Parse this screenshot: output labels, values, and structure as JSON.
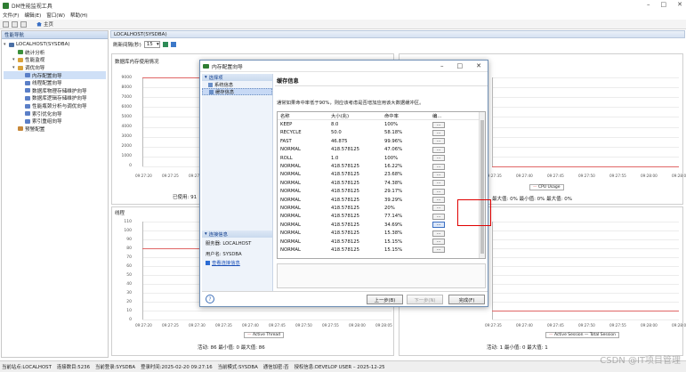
{
  "app": {
    "title": "DM性能监视工具",
    "icon": "app-icon"
  },
  "menu": [
    "文件(F)",
    "编辑(E)",
    "窗口(W)",
    "帮助(H)"
  ],
  "toolbar": {
    "home_label": "主页"
  },
  "left_panel": {
    "title": "性能导航",
    "tree": [
      {
        "label": "LOCALHOST(SYSDBA)",
        "level": 0,
        "icon": "server-icon"
      },
      {
        "label": "统计分析",
        "level": 1,
        "icon": "stats-icon"
      },
      {
        "label": "性能监视",
        "level": 1,
        "icon": "folder-icon"
      },
      {
        "label": "调优向导",
        "level": 1,
        "icon": "folder-icon"
      },
      {
        "label": "内存配置向导",
        "level": 2,
        "icon": "wizard-icon",
        "selected": true
      },
      {
        "label": "线程配置向导",
        "level": 2,
        "icon": "wizard-icon"
      },
      {
        "label": "数据库物理存储维护向导",
        "level": 2,
        "icon": "wizard-icon"
      },
      {
        "label": "数据库逻辑存储维护向导",
        "level": 2,
        "icon": "wizard-icon"
      },
      {
        "label": "性能瓶颈分析与调优向导",
        "level": 2,
        "icon": "wizard-icon"
      },
      {
        "label": "索引优化向导",
        "level": 2,
        "icon": "wizard-icon"
      },
      {
        "label": "索引重组向导",
        "level": 2,
        "icon": "wizard-icon"
      },
      {
        "label": "预警配置",
        "level": 1,
        "icon": "alert-icon"
      }
    ]
  },
  "main": {
    "tab": "LOCALHOST(SYSDBA)",
    "refresh_label": "刷新间隔(秒)",
    "refresh_value": "15",
    "mem_chart": {
      "title": "数据库内存使用情况",
      "yticks": [
        "9000",
        "8000",
        "7000",
        "6000",
        "5000",
        "4000",
        "3000",
        "2000",
        "1000",
        "0"
      ],
      "xticks": [
        "09:27:20",
        "09:27:25",
        "09:27:30"
      ],
      "status": "已使用: 91"
    },
    "cpu_chart": {
      "xticks": [
        "09:27:35",
        "09:27:40",
        "09:27:45",
        "09:27:50",
        "09:27:55",
        "09:28:00",
        "09:28:05"
      ],
      "legend": "CPU Usage",
      "status": "最大值: 0%   最小值: 0%   最大值: 0%"
    },
    "thread_chart": {
      "title": "线程",
      "yticks": [
        "110",
        "100",
        "90",
        "80",
        "70",
        "60",
        "50",
        "40",
        "30",
        "20",
        "10",
        "0"
      ],
      "xticks": [
        "09:27:20",
        "09:27:25",
        "09:27:30",
        "09:27:35",
        "09:27:40",
        "09:27:45",
        "09:27:50",
        "09:27:55",
        "09:28:00",
        "09:28:05"
      ],
      "legend": "Active Thread",
      "status": "活动: 86   最小值: 0   最大值: 86"
    },
    "session_chart": {
      "xticks": [
        "09:27:35",
        "09:27:40",
        "09:27:45",
        "09:27:50",
        "09:27:55",
        "09:28:00",
        "09:28:05"
      ],
      "legend": "Active Session — Total Session",
      "status": "活动: 1   最小值: 0   最大值: 1"
    }
  },
  "dialog": {
    "title": "内存配置向导",
    "left": {
      "section1": "选择项",
      "items": [
        "系统信息",
        "缓存信息"
      ],
      "section2": "连接信息",
      "server_label": "服务器: LOCALHOST",
      "user_label": "用户名: SYSDBA",
      "link": "查看连接信息"
    },
    "section_title": "缓存信息",
    "description": "通常如果命中率低于90%，则应该考虑是否增加应用该大数据缓冲区。",
    "columns": [
      "名称",
      "大小(兆)",
      "命中率",
      "编..."
    ],
    "rows": [
      [
        "KEEP",
        "8.0",
        "100%"
      ],
      [
        "RECYCLE",
        "50.0",
        "58.18%"
      ],
      [
        "FAST",
        "46.875",
        "99.96%"
      ],
      [
        "NORMAL",
        "418.578125",
        "47.06%"
      ],
      [
        "ROLL",
        "1.0",
        "100%"
      ],
      [
        "NORMAL",
        "418.578125",
        "16.22%"
      ],
      [
        "NORMAL",
        "418.578125",
        "23.68%"
      ],
      [
        "NORMAL",
        "418.578125",
        "74.38%"
      ],
      [
        "NORMAL",
        "418.578125",
        "29.17%"
      ],
      [
        "NORMAL",
        "418.578125",
        "39.29%"
      ],
      [
        "NORMAL",
        "418.578125",
        "20%"
      ],
      [
        "NORMAL",
        "418.578125",
        "77.14%"
      ],
      [
        "NORMAL",
        "418.578125",
        "34.69%"
      ],
      [
        "NORMAL",
        "418.578125",
        "15.38%"
      ],
      [
        "NORMAL",
        "418.578125",
        "15.15%"
      ],
      [
        "NORMAL",
        "418.578125",
        "15.15%"
      ]
    ],
    "edit_button": "...",
    "buttons": {
      "prev": "上一步(B)",
      "next": "下一步(N)",
      "finish": "完成(F)"
    }
  },
  "statusbar": {
    "site": "当前站点:LOCALHOST",
    "conn": "连接数目:5236",
    "login": "当前登录:SYSDBA",
    "login_time": "登录时间:2025-02-20 09:27:16",
    "mode": "当前模式:SYSDBA",
    "comm": "通信加密:否",
    "license": "授权信息:DEVELOP USER – 2025-12-25"
  },
  "watermark": "CSDN @IT项目管理"
}
